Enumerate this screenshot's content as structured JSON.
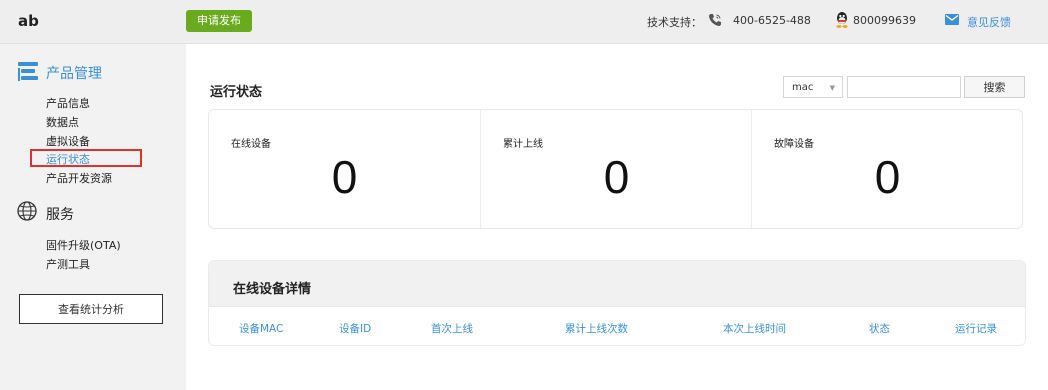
{
  "header": {
    "logo": "ab",
    "publish_button": "申请发布",
    "support_label": "技术支持：",
    "phone": "400-6525-488",
    "qq": "800099639",
    "feedback": "意见反馈"
  },
  "sidebar": {
    "sections": [
      {
        "title": "产品管理",
        "icon": "product-list-icon",
        "items": [
          "产品信息",
          "数据点",
          "虚拟设备",
          "运行状态",
          "产品开发资源"
        ],
        "active_item": "运行状态"
      },
      {
        "title": "服务",
        "icon": "globe-icon",
        "items": [
          "固件升级(OTA)",
          "产测工具"
        ]
      }
    ],
    "stats_button": "查看统计分析"
  },
  "main": {
    "title": "运行状态",
    "filter": {
      "selected": "mac",
      "search_value": "",
      "search_button": "搜索"
    },
    "stats": [
      {
        "label": "在线设备",
        "value": "0"
      },
      {
        "label": "累计上线",
        "value": "0"
      },
      {
        "label": "故障设备",
        "value": "0"
      }
    ],
    "detail": {
      "title": "在线设备详情",
      "columns": [
        "设备MAC",
        "设备ID",
        "首次上线",
        "累计上线次数",
        "本次上线时间",
        "状态",
        "运行记录"
      ]
    }
  },
  "colors": {
    "accent": "#3a8fd9",
    "publish_green": "#6aaa1e",
    "highlight_red": "#e0312b"
  }
}
